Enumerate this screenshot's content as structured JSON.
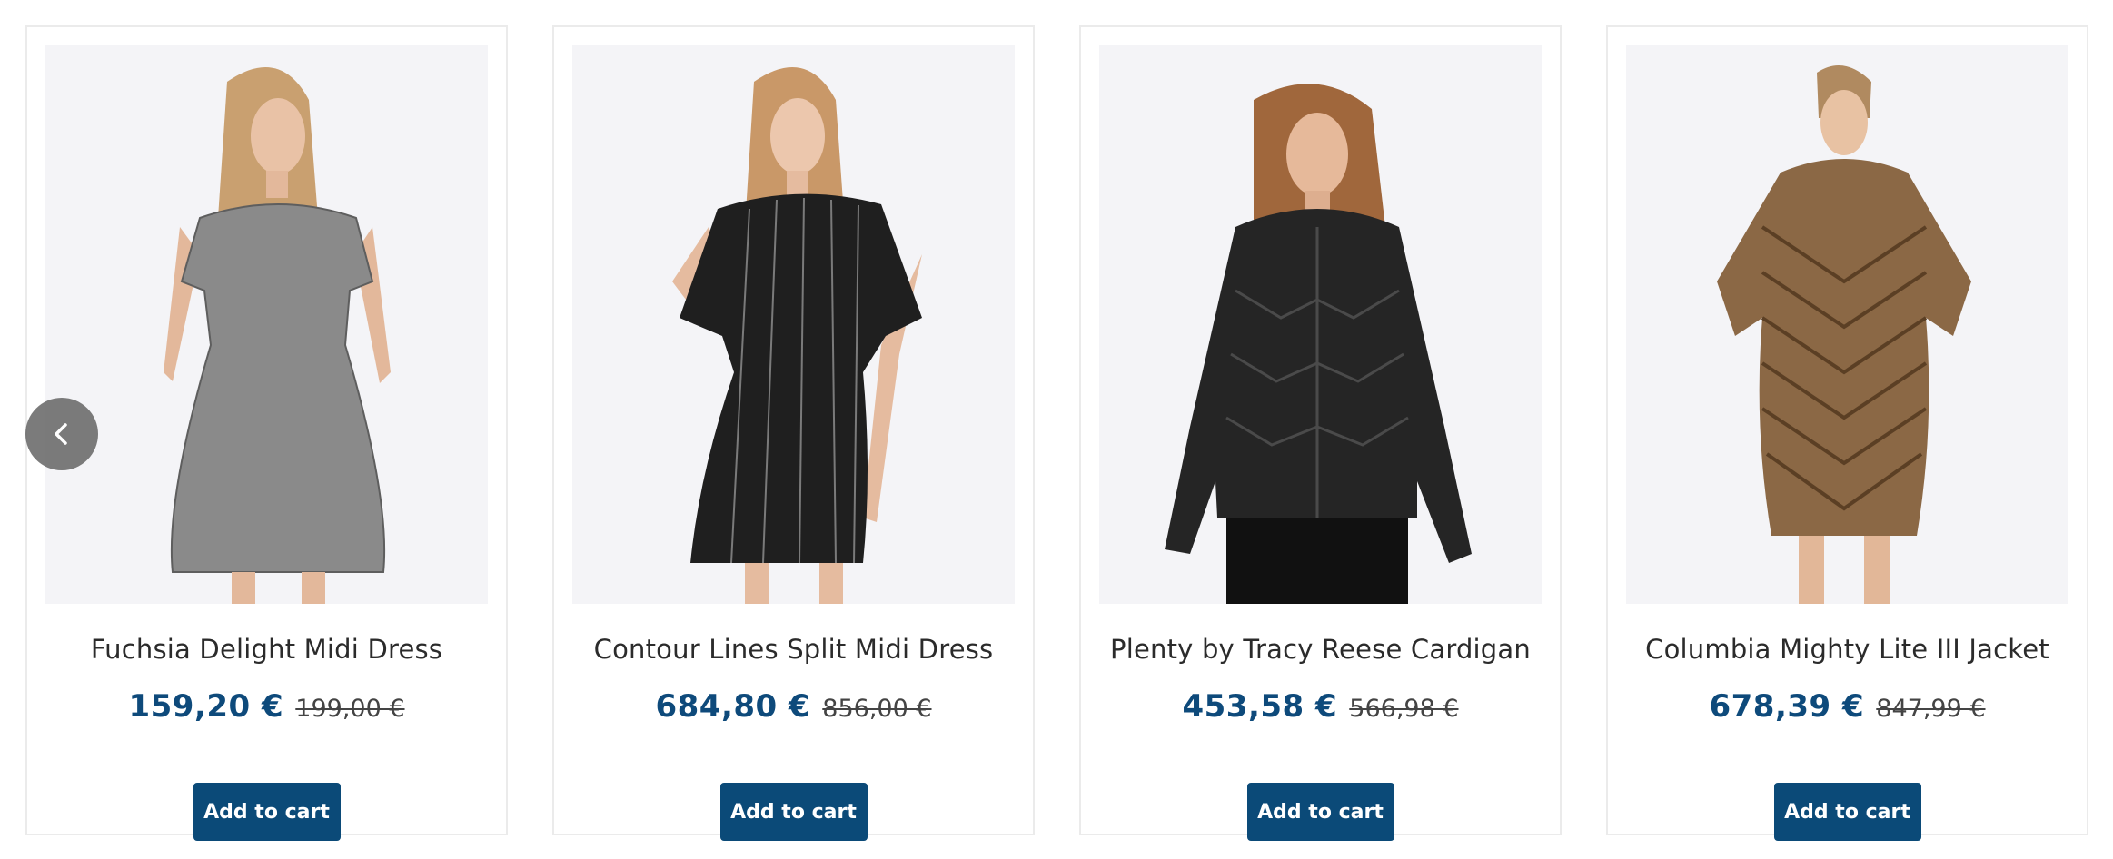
{
  "products": [
    {
      "name": "Fuchsia Delight Midi Dress",
      "price": "159,20 €",
      "old_price": "199,00 €",
      "button_label": "Add to cart",
      "image": "woman in grey floral short-sleeve midi dress"
    },
    {
      "name": "Contour Lines Split Midi Dress",
      "price": "684,80 €",
      "old_price": "856,00 €",
      "button_label": "Add to cart",
      "image": "woman in black striped shirt dress"
    },
    {
      "name": "Plenty by Tracy Reese Cardigan",
      "price": "453,58 €",
      "old_price": "566,98 €",
      "button_label": "Add to cart",
      "image": "woman in black quilted puffer jacket"
    },
    {
      "name": "Columbia Mighty Lite III Jacket",
      "price": "678,39 €",
      "old_price": "847,99 €",
      "button_label": "Add to cart",
      "image": "woman in brown fur coat"
    }
  ],
  "navigation": {
    "prev_icon": "chevron-left-icon"
  },
  "colors": {
    "price": "#0e4a7b",
    "button_bg": "#0b4a78",
    "image_bg": "#f4f4f7",
    "card_border": "#ebebeb",
    "arrow_bg": "#646464"
  }
}
